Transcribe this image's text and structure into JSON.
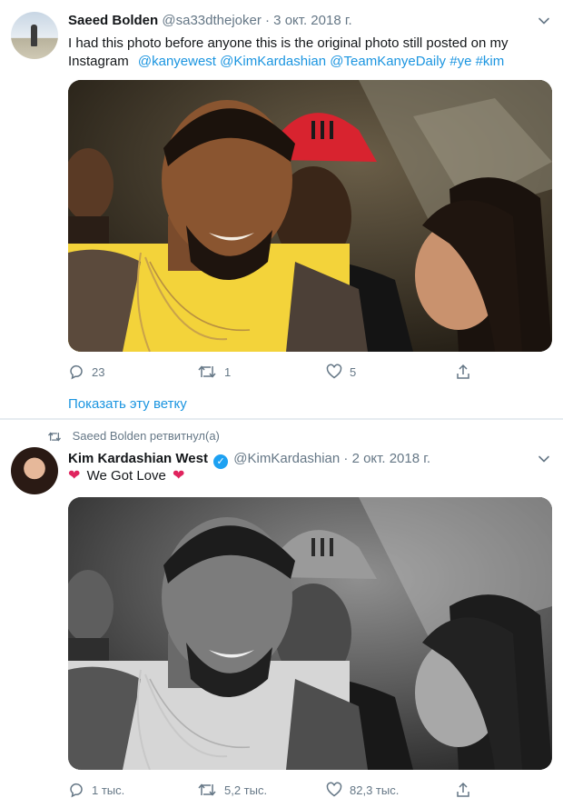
{
  "tweet1": {
    "display_name": "Saeed Bolden",
    "handle": "@sa33dthejoker",
    "date": "· 3 окт. 2018 г.",
    "text": "I had this photo before anyone this is the original photo still posted on my Instagram",
    "mentions": [
      "@kanyewest",
      "@KimKardashian",
      "@TeamKanyeDaily",
      "#ye",
      "#kim"
    ],
    "reply_count": "23",
    "retweet_count": "1",
    "like_count": "5",
    "show_thread": "Показать эту ветку"
  },
  "retweet_context": {
    "text": "Saeed Bolden ретвитнул(а)"
  },
  "tweet2": {
    "display_name": "Kim Kardashian West",
    "handle": "@KimKardashian",
    "date": "· 2 окт. 2018 г.",
    "text": "We Got Love",
    "heart_glyph": "❤",
    "reply_count": "1 тыс.",
    "retweet_count": "5,2 тыс.",
    "like_count": "82,3 тыс."
  },
  "icons": {
    "reply": "comment-bubble-icon",
    "retweet": "retweet-arrows-icon",
    "like": "heart-outline-icon",
    "share": "share-upload-icon",
    "menu": "chevron-down-icon",
    "verified": "verified-badge-icon"
  },
  "colors": {
    "link": "#1b95e0",
    "muted": "#657786",
    "verified": "#1da1f2",
    "heart": "#e0245e",
    "separator": "#e6ecf0"
  }
}
